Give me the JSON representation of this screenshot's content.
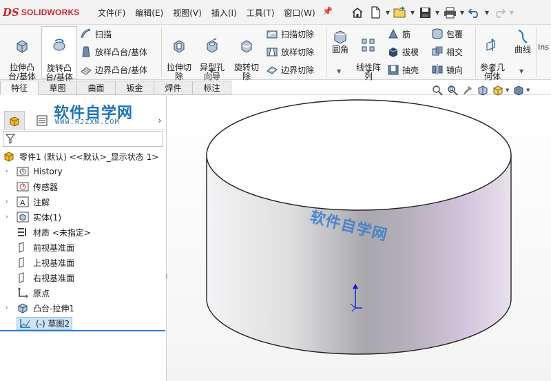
{
  "app": {
    "logo_prefix": "DS",
    "logo_name": "SOLIDWORKS"
  },
  "menu": [
    "文件(F)",
    "编辑(E)",
    "视图(V)",
    "插入(I)",
    "工具(T)",
    "窗口(W)"
  ],
  "quick_access": [
    "home-icon",
    "new-doc-icon",
    "open-icon",
    "save-icon",
    "print-icon",
    "undo-icon",
    "redo-icon"
  ],
  "ribbon": {
    "extrude_boss": "拉伸凸\n台/基体",
    "revolve_boss": "旋转凸\n台/基体",
    "sweep": "扫描",
    "loft_boss": "放样凸台/基体",
    "boundary_boss": "边界凸台/基体",
    "extrude_cut": "拉伸切\n除",
    "hole_wizard": "异型孔\n向导",
    "revolve_cut": "旋转切\n除",
    "swept_cut": "扫描切除",
    "lofted_cut": "放样切除",
    "boundary_cut": "边界切除",
    "fillet": "圆角",
    "linear_pattern": "线性阵\n列",
    "rib": "筋",
    "draft": "拔模",
    "shell": "抽壳",
    "wrap": "包覆",
    "intersect": "相交",
    "mirror": "镜向",
    "ref_geometry": "参考几\n何体",
    "curves": "曲线",
    "instant3d": "Ins"
  },
  "tabs": [
    "特征",
    "草图",
    "曲面",
    "钣金",
    "焊件",
    "标注"
  ],
  "watermark": {
    "cn": "软件自学网",
    "url": "WWW.RJZXW.COM"
  },
  "tree": {
    "part": "零件1 (默认) <<默认>_显示状态 1>",
    "items": [
      {
        "label": "History",
        "icon": "history-icon"
      },
      {
        "label": "传感器",
        "icon": "sensor-icon"
      },
      {
        "label": "注解",
        "icon": "annotation-icon"
      },
      {
        "label": "实体(1)",
        "icon": "solid-body-icon"
      },
      {
        "label": "材质 <未指定>",
        "icon": "material-icon"
      },
      {
        "label": "前视基准面",
        "icon": "plane-icon"
      },
      {
        "label": "上视基准面",
        "icon": "plane-icon"
      },
      {
        "label": "右视基准面",
        "icon": "plane-icon"
      },
      {
        "label": "原点",
        "icon": "origin-icon"
      },
      {
        "label": "凸台-拉伸1",
        "icon": "extrude-icon"
      },
      {
        "label": "(-) 草图2",
        "icon": "sketch-icon"
      }
    ]
  },
  "colors": {
    "brand": "#d2252b",
    "accent": "#2a7fd0",
    "watermark": "#1f73b7"
  }
}
